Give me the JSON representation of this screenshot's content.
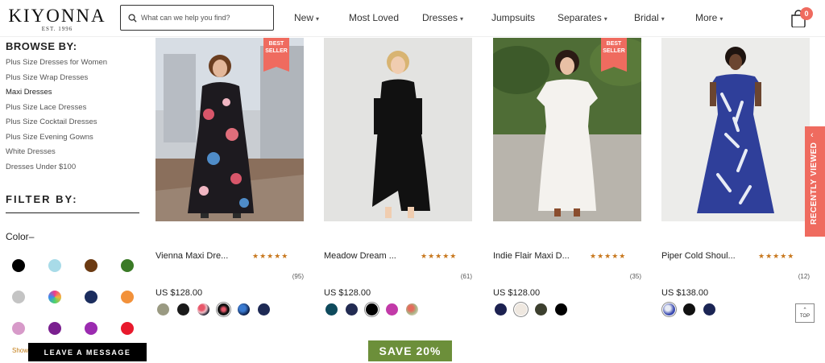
{
  "header": {
    "logo_name": "KIYONNA",
    "logo_est": "EST. 1996",
    "search_placeholder": "What can we help you find?",
    "nav": [
      {
        "label": "New",
        "dropdown": true
      },
      {
        "label": "Most Loved",
        "dropdown": false
      },
      {
        "label": "Dresses",
        "dropdown": true
      },
      {
        "label": "Jumpsuits",
        "dropdown": false
      },
      {
        "label": "Separates",
        "dropdown": true
      },
      {
        "label": "Bridal",
        "dropdown": true
      },
      {
        "label": "More",
        "dropdown": true
      }
    ],
    "cart_count": "0",
    "icons": {
      "search": "search-icon",
      "cart": "shopping-bag-icon",
      "dropdown": "chevron-down-icon"
    }
  },
  "sidebar": {
    "browse_title": "BROWSE BY:",
    "browse_items": [
      "Plus Size Dresses for Women",
      "Plus Size Wrap Dresses",
      "Maxi Dresses",
      "Plus Size Lace Dresses",
      "Plus Size Cocktail Dresses",
      "Plus Size Evening Gowns",
      "White Dresses",
      "Dresses Under $100"
    ],
    "active_index": 2,
    "filter_title": "FILTER BY:",
    "color_title": "Color",
    "color_toggle": "–",
    "colors": [
      "#000000",
      "#a8dbe8",
      "#6b3a12",
      "#3a7a26",
      "#c4c4c4",
      "multicolor",
      "#1b2d5e",
      "#f2913a",
      "#d79ac9",
      "#7a1f8f",
      "#9b2bb0",
      "#e8192c"
    ],
    "show_more": "Show",
    "leave_message": "LEAVE A MESSAGE"
  },
  "products": [
    {
      "name": "Vienna Maxi Dre...",
      "best_seller": true,
      "best_seller_label": [
        "BEST",
        "SELLER"
      ],
      "stars": "★★★★★",
      "rating": 5,
      "reviews": "(95)",
      "price": "US $128.00",
      "swatches": [
        "#9a9a82",
        "#1a1a1a",
        "pattern-floral-red",
        "pattern-floral-black",
        "pattern-blue",
        "#1e2a55"
      ]
    },
    {
      "name": "Meadow Dream ...",
      "best_seller": false,
      "stars": "★★★★★",
      "rating": 5,
      "reviews": "(61)",
      "price": "US $128.00",
      "swatches": [
        "#0e4a5c",
        "#222b52",
        "#000000",
        "#c23aa8",
        "pattern-floral-mixed"
      ]
    },
    {
      "name": "Indie Flair Maxi D...",
      "best_seller": true,
      "best_seller_label": [
        "BEST",
        "SELLER"
      ],
      "stars": "★★★★★",
      "rating": 4.5,
      "reviews": "(35)",
      "price": "US $128.00",
      "swatches": [
        "#1c2150",
        "#efe8e0",
        "#3c3f2e",
        "#000000"
      ]
    },
    {
      "name": "Piper Cold Shoul...",
      "best_seller": false,
      "stars": "★★★★★",
      "rating": 5,
      "reviews": "(12)",
      "price": "US $138.00",
      "swatches": [
        "pattern-blue-leaf",
        "#111111",
        "#1b2554"
      ]
    }
  ],
  "recently_viewed": "RECENTLY VIEWED",
  "top_button": {
    "arrow": "^",
    "label": "TOP"
  },
  "promo": "SAVE 20%"
}
